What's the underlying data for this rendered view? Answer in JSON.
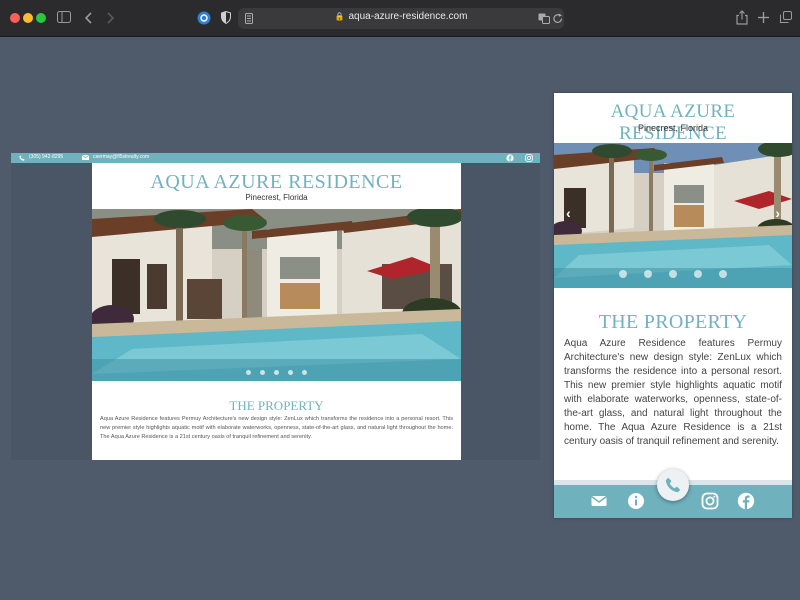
{
  "browser": {
    "url": "aqua-azure-residence.com"
  },
  "desktop": {
    "topbar": {
      "phone": "(305) 942-8295",
      "email": "caermay@fl5strealty.com"
    },
    "title": "AQUA AZURE RESIDENCE",
    "location": "Pinecrest, Florida",
    "section_title": "THE PROPERTY",
    "paragraph": "Aqua Azure Residence features Permuy Architecture's new design style: ZenLux which transforms the residence into a personal resort. This new premier style highlights aquatic motif with elaborate waterworks, openness, state-of-the-art glass, and natural light throughout the home. The Aqua Azure Residence is a 21st century oasis of tranquil refinement and serenity."
  },
  "mobile": {
    "title": "AQUA AZURE RESIDENCE",
    "location": "Pinecrest, Florida",
    "section_title": "THE PROPERTY",
    "paragraph": "Aqua Azure Residence features Permuy Architecture's new design style: ZenLux which transforms the residence into a personal resort. This new premier style highlights aquatic motif with elaborate waterworks, openness, state-of-the-art glass, and natural light throughout the home. The Aqua Azure Residence is a 21st century oasis of tranquil refinement and serenity."
  },
  "colors": {
    "accent": "#72b2bf",
    "background": "#4f5b6b",
    "chrome": "#2b2b2d"
  },
  "icons": [
    "sidebar-icon",
    "back-icon",
    "forward-icon",
    "extension-icon",
    "shield-icon",
    "reader-icon",
    "lock-icon",
    "translate-icon",
    "reload-icon",
    "share-icon",
    "new-tab-icon",
    "tabs-icon",
    "phone-icon",
    "mail-icon",
    "info-icon",
    "instagram-icon",
    "facebook-icon",
    "chevron-left-icon",
    "chevron-right-icon"
  ]
}
